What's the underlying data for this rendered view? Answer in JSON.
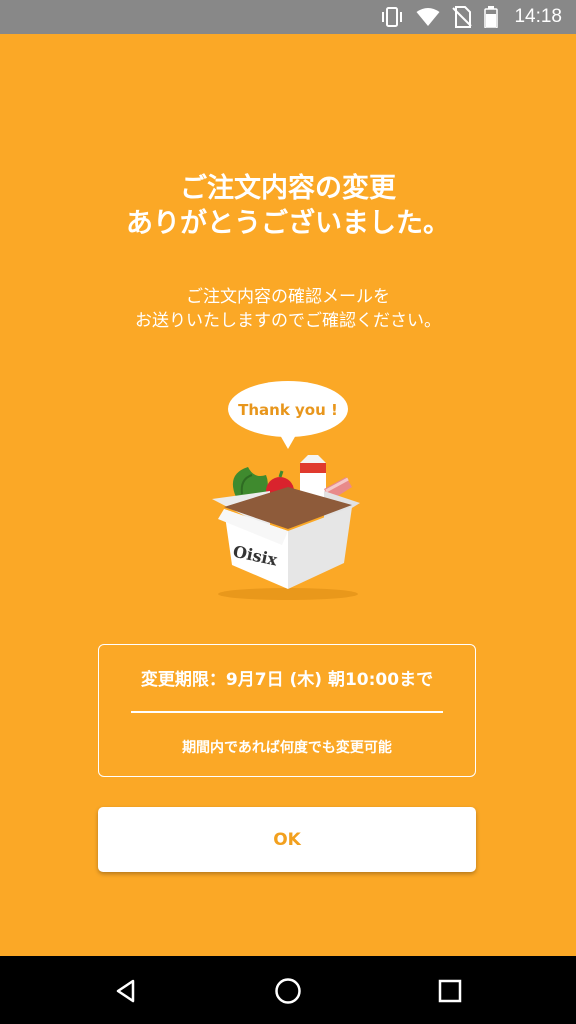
{
  "status_bar": {
    "time": "14:18",
    "icons": [
      "vibrate-icon",
      "wifi-icon",
      "no-sim-icon",
      "battery-icon"
    ]
  },
  "confirmation": {
    "title_line1": "ご注文内容の変更",
    "title_line2": "ありがとうございました。",
    "message_line1": "ご注文内容の確認メールを",
    "message_line2": "お送りいたしますのでご確認ください。"
  },
  "illustration": {
    "speech_bubble_text": "Thank you !",
    "box_logo": "Oisix"
  },
  "info_box": {
    "deadline": "変更期限：9月7日 (木) 朝10:00まで",
    "note": "期間内であれば何度でも変更可能"
  },
  "ok_button_label": "OK",
  "colors": {
    "background": "#FBA826",
    "status_bar": "#888888",
    "button_text": "#F2A01E",
    "nav_bar": "#000000"
  },
  "nav_bar": {
    "icons": [
      "back-icon",
      "home-icon",
      "recents-icon"
    ]
  }
}
